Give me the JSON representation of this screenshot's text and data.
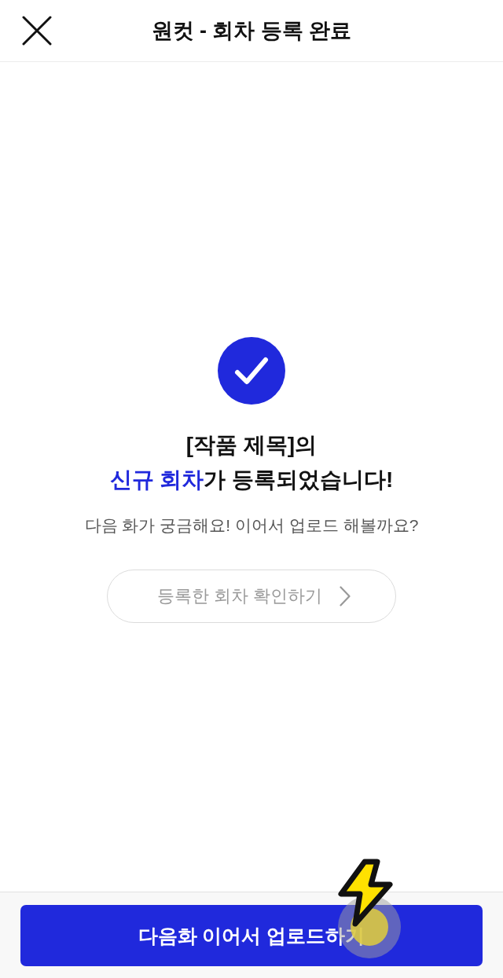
{
  "header": {
    "title": "원컷 - 회차 등록 완료"
  },
  "result": {
    "title_lines": [
      [
        {
          "text": "[작품 제목]의",
          "highlight": false
        }
      ],
      [
        {
          "text": "신규 회차",
          "highlight": true
        },
        {
          "text": "가 등록되었습니다!",
          "highlight": false
        }
      ]
    ],
    "subtitle": "다음 화가 궁금해요! 이어서 업로드 해볼까요?",
    "link_button": "등록한 회차 확인하기"
  },
  "footer": {
    "primary_button": "다음화 이어서 업로드하기"
  }
}
